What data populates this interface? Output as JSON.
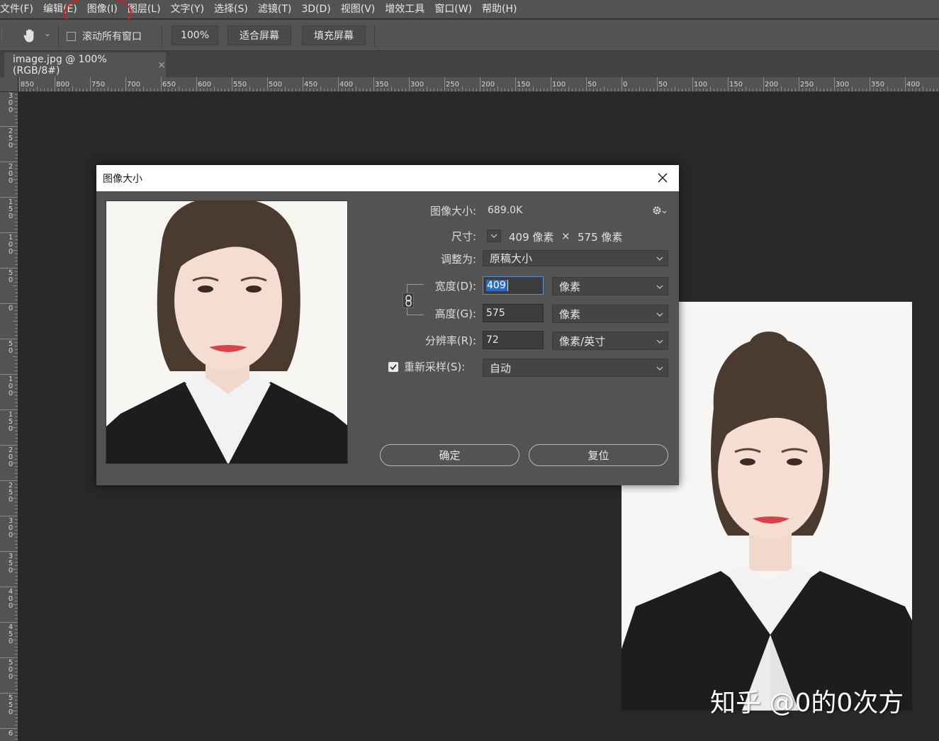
{
  "menu": [
    "文件(F)",
    "编辑(E)",
    "图像(I)",
    "图层(L)",
    "文字(Y)",
    "选择(S)",
    "滤镜(T)",
    "3D(D)",
    "视图(V)",
    "增效工具",
    "窗口(W)",
    "帮助(H)"
  ],
  "options": {
    "scroll_all_windows": "滚动所有窗口",
    "zoom_100": "100%",
    "fit_screen": "适合屏幕",
    "fill_screen": "填充屏幕"
  },
  "document_tab": {
    "title": "image.jpg @ 100%(RGB/8#)",
    "close": "×"
  },
  "ruler": {
    "horizontal": [
      "850",
      "800",
      "750",
      "700",
      "650",
      "600",
      "550",
      "500",
      "450",
      "400",
      "350",
      "300",
      "250",
      "200",
      "150",
      "100",
      "50",
      "0",
      "50",
      "100",
      "150",
      "200",
      "250",
      "300",
      "350",
      "400"
    ],
    "vertical": [
      "300",
      "250",
      "200",
      "150",
      "100",
      "50",
      "0",
      "50",
      "100",
      "150",
      "200",
      "250",
      "300",
      "350",
      "400",
      "450",
      "500",
      "550",
      "6"
    ]
  },
  "dialog": {
    "title": "图像大小",
    "image_size_label": "图像大小:",
    "image_size_value": "689.0K",
    "dimensions_label": "尺寸:",
    "dim_width": "409 像素",
    "dim_times": "×",
    "dim_height": "575 像素",
    "fit_to_label": "调整为:",
    "fit_to_value": "原稿大小",
    "width_label": "宽度(D):",
    "width_value": "409",
    "width_unit": "像素",
    "height_label": "高度(G):",
    "height_value": "575",
    "height_unit": "像素",
    "resolution_label": "分辨率(R):",
    "resolution_value": "72",
    "resolution_unit": "像素/英寸",
    "resample_label": "重新采样(S):",
    "resample_value": "自动",
    "ok_label": "确定",
    "reset_label": "复位"
  },
  "watermark": "知乎 @0的0次方",
  "colors": {
    "app_bg": "#282828",
    "panel": "#535353",
    "highlight_circle": "#d81f26",
    "selection": "#2b6cc4"
  }
}
